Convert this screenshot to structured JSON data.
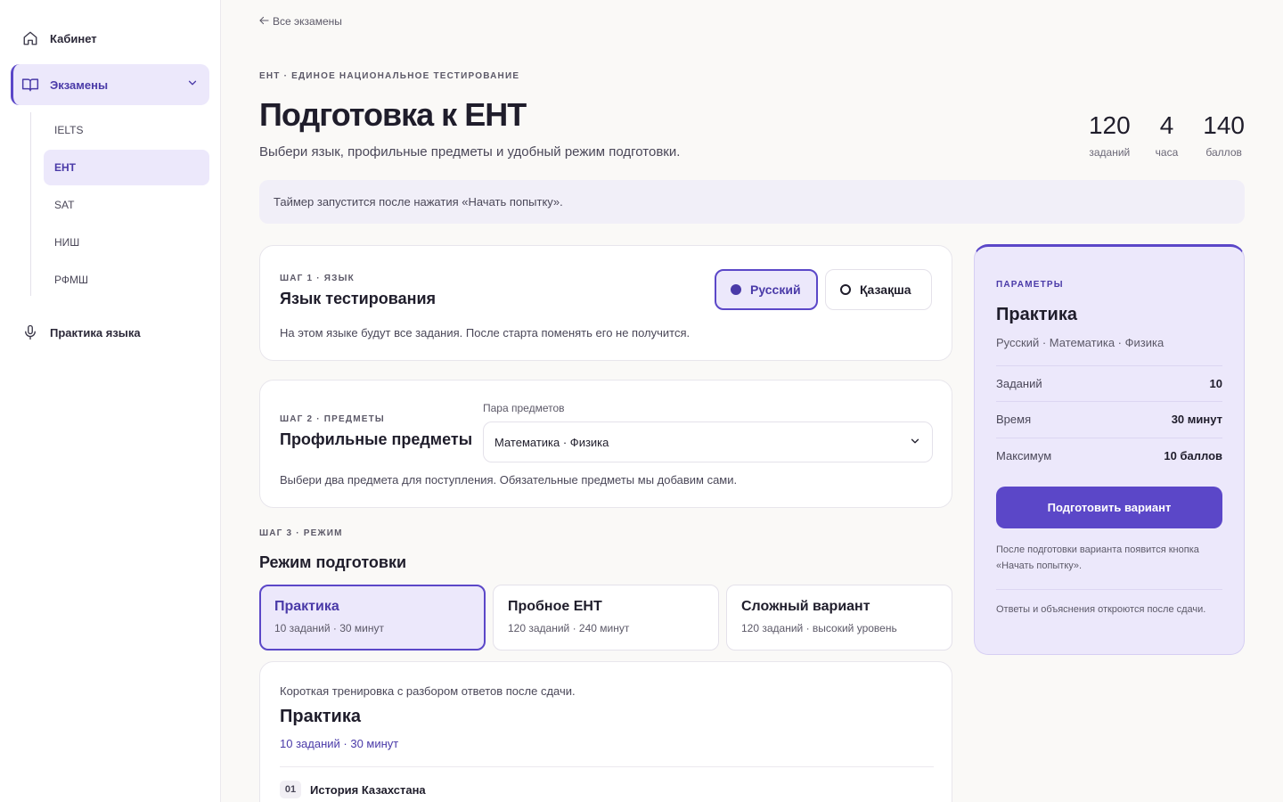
{
  "sidebar": {
    "home": {
      "label": "Кабинет",
      "icon": "home-icon"
    },
    "exams": {
      "label": "Экзамены",
      "icon": "book-icon"
    },
    "sub_items": [
      {
        "label": "IELTS"
      },
      {
        "label": "ЕНТ"
      },
      {
        "label": "SAT"
      },
      {
        "label": "НИШ"
      },
      {
        "label": "РФМШ"
      }
    ],
    "practice": {
      "label": "Практика языка",
      "icon": "microphone-icon"
    }
  },
  "back_link": "Все экзамены",
  "eyebrow": "ЕНТ · ЕДИНОЕ НАЦИОНАЛЬНОЕ ТЕСТИРОВАНИЕ",
  "title": "Подготовка к ЕНТ",
  "subtitle": "Выбери язык, профильные предметы и удобный режим подготовки.",
  "stats": [
    {
      "value": "120",
      "label": "заданий"
    },
    {
      "value": "4",
      "label": "часа"
    },
    {
      "value": "140",
      "label": "баллов"
    }
  ],
  "timer_note": "Таймер запустится после нажатия «Начать попытку».",
  "step1": {
    "label": "ШАГ 1 · ЯЗЫК",
    "title": "Язык тестирования",
    "desc": "На этом языке будут все задания. После старта поменять его не получится.",
    "options": [
      "Русский",
      "Қазақша"
    ],
    "selected": "Русский"
  },
  "step2": {
    "label": "ШАГ 2 · ПРЕДМЕТЫ",
    "title": "Профильные предметы",
    "select_label": "Пара предметов",
    "select_value": "Математика · Физика",
    "desc": "Выбери два предмета для поступления. Обязательные предметы мы добавим сами."
  },
  "step3": {
    "label": "ШАГ 3 · РЕЖИМ",
    "title": "Режим подготовки",
    "modes": [
      {
        "title": "Практика",
        "sub": "10 заданий · 30 минут"
      },
      {
        "title": "Пробное ЕНТ",
        "sub": "120 заданий · 240 минут"
      },
      {
        "title": "Сложный вариант",
        "sub": "120 заданий · высокий уровень"
      }
    ],
    "selected": "Практика"
  },
  "detail": {
    "desc": "Короткая тренировка с разбором ответов после сдачи.",
    "title": "Практика",
    "meta": "10 заданий · 30 минут",
    "subjects": [
      {
        "num": "01",
        "name": "История Казахстана"
      }
    ]
  },
  "panel": {
    "eyebrow": "ПАРАМЕТРЫ",
    "title": "Практика",
    "sub": "Русский · Математика · Физика",
    "rows": [
      {
        "k": "Заданий",
        "v": "10"
      },
      {
        "k": "Время",
        "v": "30 минут"
      },
      {
        "k": "Максимум",
        "v": "10 баллов"
      }
    ],
    "button": "Подготовить вариант",
    "note1": "После подготовки варианта появится кнопка «Начать попытку».",
    "note2": "Ответы и объяснения откроются после сдачи."
  },
  "colors": {
    "accent": "#5b47c8",
    "accent_soft": "#ece8fb",
    "background": "#faf9f7"
  }
}
